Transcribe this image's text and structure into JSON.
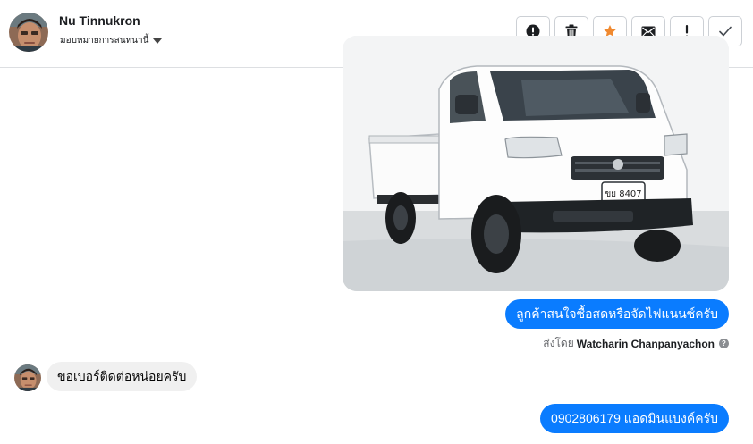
{
  "header": {
    "contact_name": "Nu Tinnukron",
    "assign_label": "มอบหมายการสนทนานี้",
    "actions": [
      {
        "icon": "alert-circle-icon",
        "name": "mark-spam-button"
      },
      {
        "icon": "trash-icon",
        "name": "delete-button"
      },
      {
        "icon": "star-icon",
        "name": "follow-up-button",
        "color": "#f0892f"
      },
      {
        "icon": "envelope-icon",
        "name": "mark-unread-button"
      },
      {
        "icon": "exclamation-icon",
        "name": "priority-button"
      },
      {
        "icon": "check-icon",
        "name": "mark-done-button"
      }
    ]
  },
  "messages": {
    "photo_plate": "ขย 8407",
    "outgoing_1": "ลูกค้าสนใจซื้อสดหรือจัดไฟแนนซ์ครับ",
    "sent_by_label": "ส่งโดย",
    "sent_by_name": "Watcharin Chanpanyachon",
    "incoming_1": "ขอเบอร์ติดต่อหน่อยครับ",
    "outgoing_2": "0902806179 แอดมินแบงค์ครับ"
  },
  "colors": {
    "outgoing_bubble": "#0a7cff",
    "incoming_bubble": "#f0f0f0",
    "star": "#f0892f"
  }
}
